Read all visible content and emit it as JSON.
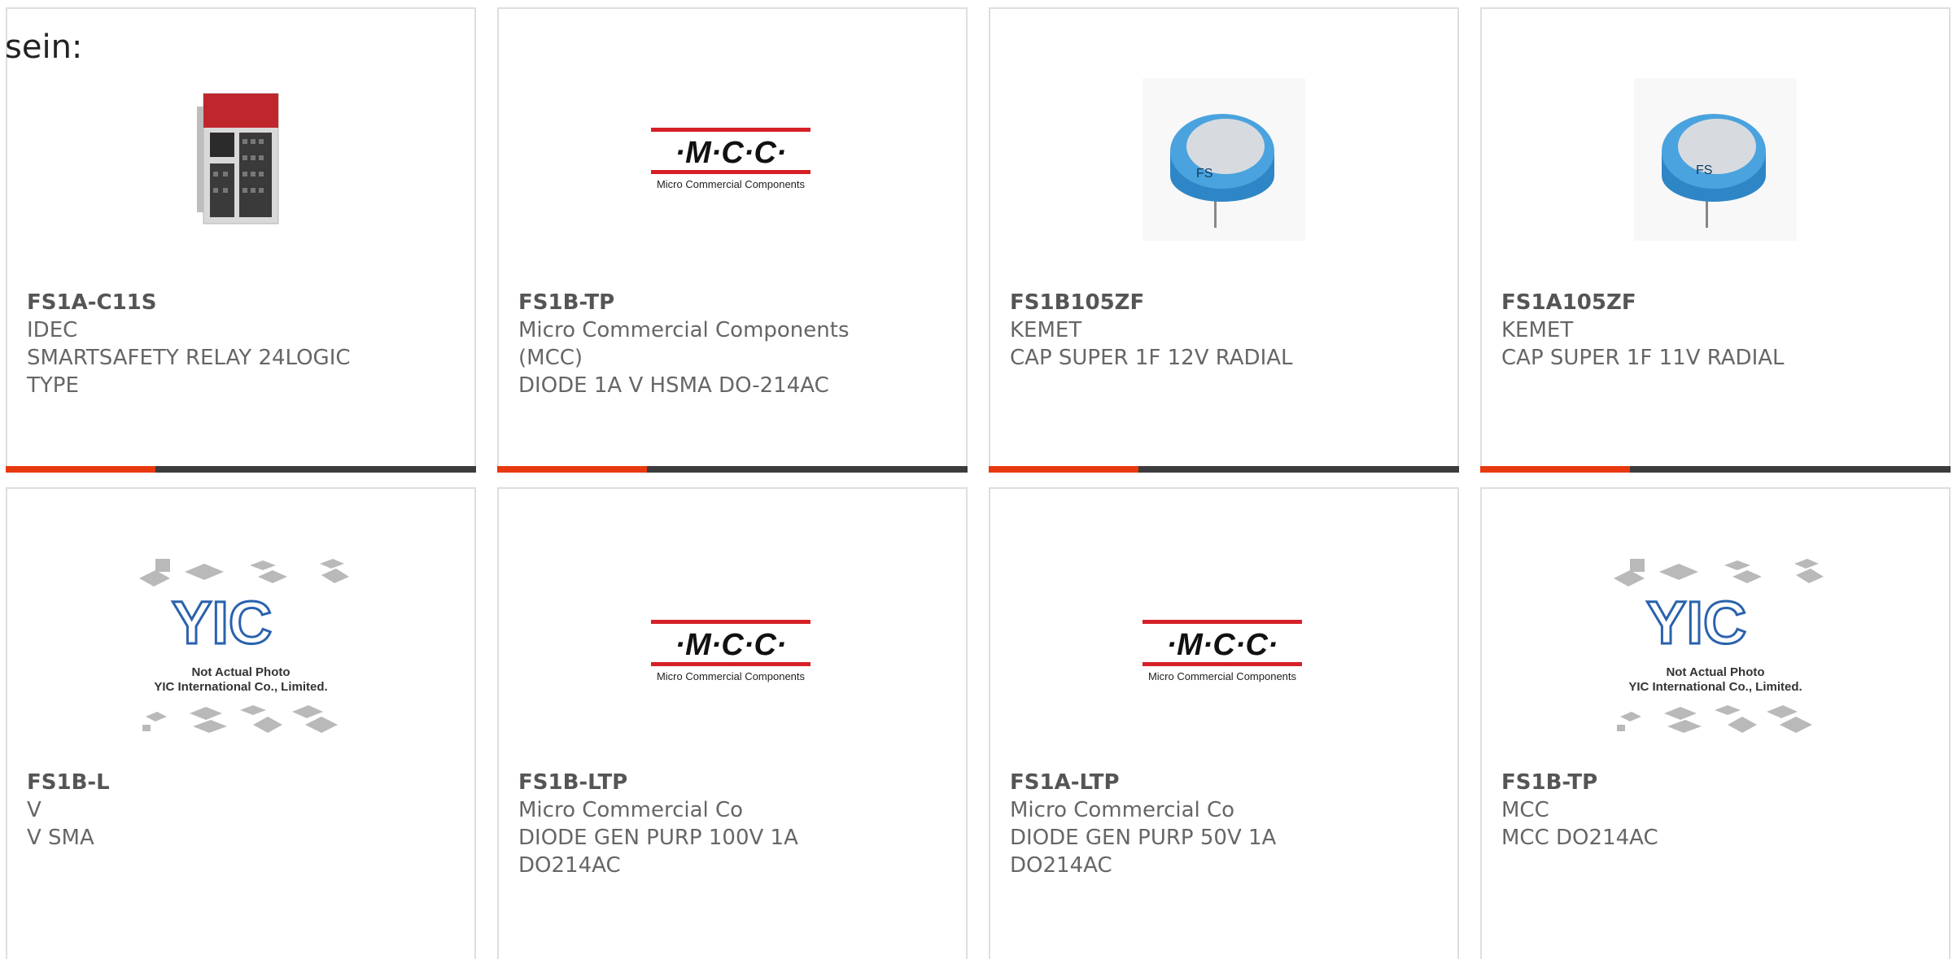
{
  "intro": "sein:",
  "colors": {
    "accent": "#e8380d",
    "bar_dark": "#3c3c3c",
    "mcc_red": "#d62027"
  },
  "products": [
    {
      "part": "FS1A-C11S",
      "lines": [
        "IDEC",
        "SMARTSAFETY RELAY 24LOGIC",
        "TYPE"
      ],
      "image": "relay-module-photo"
    },
    {
      "part": "FS1B-TP",
      "lines": [
        "Micro Commercial Components",
        "(MCC)",
        "DIODE 1A V HSMA DO-214AC"
      ],
      "image": "mcc-logo"
    },
    {
      "part": "FS1B105ZF",
      "lines": [
        "KEMET",
        "CAP SUPER 1F 12V RADIAL"
      ],
      "image": "supercap-photo"
    },
    {
      "part": "FS1A105ZF",
      "lines": [
        "KEMET",
        "CAP SUPER 1F 11V RADIAL"
      ],
      "image": "supercap-photo"
    },
    {
      "part": "FS1B-L",
      "lines": [
        "V",
        "V SMA"
      ],
      "image": "yic-placeholder"
    },
    {
      "part": "FS1B-LTP",
      "lines": [
        "Micro Commercial Co",
        "DIODE GEN PURP 100V 1A",
        "DO214AC"
      ],
      "image": "mcc-logo"
    },
    {
      "part": "FS1A-LTP",
      "lines": [
        "Micro Commercial Co",
        "DIODE GEN PURP 50V 1A",
        "DO214AC"
      ],
      "image": "mcc-logo"
    },
    {
      "part": "FS1B-TP",
      "lines": [
        "MCC",
        "MCC DO214AC"
      ],
      "image": "yic-placeholder"
    }
  ],
  "logos": {
    "mcc_mark": "·M·C·C·",
    "mcc_sub": "Micro Commercial Components",
    "cap_print": "FS",
    "yic_placeholder_line1": "Not Actual Photo",
    "yic_placeholder_line2": "YIC International Co., Limited."
  }
}
